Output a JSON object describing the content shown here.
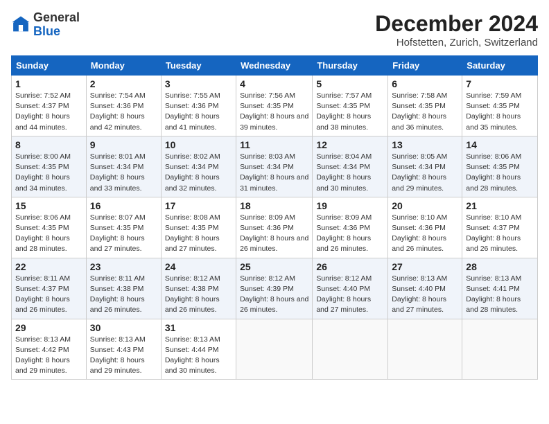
{
  "header": {
    "logo": {
      "general": "General",
      "blue": "Blue"
    },
    "title": "December 2024",
    "location": "Hofstetten, Zurich, Switzerland"
  },
  "days_of_week": [
    "Sunday",
    "Monday",
    "Tuesday",
    "Wednesday",
    "Thursday",
    "Friday",
    "Saturday"
  ],
  "weeks": [
    [
      {
        "day": "1",
        "sunrise": "7:52 AM",
        "sunset": "4:37 PM",
        "daylight": "8 hours and 44 minutes."
      },
      {
        "day": "2",
        "sunrise": "7:54 AM",
        "sunset": "4:36 PM",
        "daylight": "8 hours and 42 minutes."
      },
      {
        "day": "3",
        "sunrise": "7:55 AM",
        "sunset": "4:36 PM",
        "daylight": "8 hours and 41 minutes."
      },
      {
        "day": "4",
        "sunrise": "7:56 AM",
        "sunset": "4:35 PM",
        "daylight": "8 hours and 39 minutes."
      },
      {
        "day": "5",
        "sunrise": "7:57 AM",
        "sunset": "4:35 PM",
        "daylight": "8 hours and 38 minutes."
      },
      {
        "day": "6",
        "sunrise": "7:58 AM",
        "sunset": "4:35 PM",
        "daylight": "8 hours and 36 minutes."
      },
      {
        "day": "7",
        "sunrise": "7:59 AM",
        "sunset": "4:35 PM",
        "daylight": "8 hours and 35 minutes."
      }
    ],
    [
      {
        "day": "8",
        "sunrise": "8:00 AM",
        "sunset": "4:35 PM",
        "daylight": "8 hours and 34 minutes."
      },
      {
        "day": "9",
        "sunrise": "8:01 AM",
        "sunset": "4:34 PM",
        "daylight": "8 hours and 33 minutes."
      },
      {
        "day": "10",
        "sunrise": "8:02 AM",
        "sunset": "4:34 PM",
        "daylight": "8 hours and 32 minutes."
      },
      {
        "day": "11",
        "sunrise": "8:03 AM",
        "sunset": "4:34 PM",
        "daylight": "8 hours and 31 minutes."
      },
      {
        "day": "12",
        "sunrise": "8:04 AM",
        "sunset": "4:34 PM",
        "daylight": "8 hours and 30 minutes."
      },
      {
        "day": "13",
        "sunrise": "8:05 AM",
        "sunset": "4:34 PM",
        "daylight": "8 hours and 29 minutes."
      },
      {
        "day": "14",
        "sunrise": "8:06 AM",
        "sunset": "4:35 PM",
        "daylight": "8 hours and 28 minutes."
      }
    ],
    [
      {
        "day": "15",
        "sunrise": "8:06 AM",
        "sunset": "4:35 PM",
        "daylight": "8 hours and 28 minutes."
      },
      {
        "day": "16",
        "sunrise": "8:07 AM",
        "sunset": "4:35 PM",
        "daylight": "8 hours and 27 minutes."
      },
      {
        "day": "17",
        "sunrise": "8:08 AM",
        "sunset": "4:35 PM",
        "daylight": "8 hours and 27 minutes."
      },
      {
        "day": "18",
        "sunrise": "8:09 AM",
        "sunset": "4:36 PM",
        "daylight": "8 hours and 26 minutes."
      },
      {
        "day": "19",
        "sunrise": "8:09 AM",
        "sunset": "4:36 PM",
        "daylight": "8 hours and 26 minutes."
      },
      {
        "day": "20",
        "sunrise": "8:10 AM",
        "sunset": "4:36 PM",
        "daylight": "8 hours and 26 minutes."
      },
      {
        "day": "21",
        "sunrise": "8:10 AM",
        "sunset": "4:37 PM",
        "daylight": "8 hours and 26 minutes."
      }
    ],
    [
      {
        "day": "22",
        "sunrise": "8:11 AM",
        "sunset": "4:37 PM",
        "daylight": "8 hours and 26 minutes."
      },
      {
        "day": "23",
        "sunrise": "8:11 AM",
        "sunset": "4:38 PM",
        "daylight": "8 hours and 26 minutes."
      },
      {
        "day": "24",
        "sunrise": "8:12 AM",
        "sunset": "4:38 PM",
        "daylight": "8 hours and 26 minutes."
      },
      {
        "day": "25",
        "sunrise": "8:12 AM",
        "sunset": "4:39 PM",
        "daylight": "8 hours and 26 minutes."
      },
      {
        "day": "26",
        "sunrise": "8:12 AM",
        "sunset": "4:40 PM",
        "daylight": "8 hours and 27 minutes."
      },
      {
        "day": "27",
        "sunrise": "8:13 AM",
        "sunset": "4:40 PM",
        "daylight": "8 hours and 27 minutes."
      },
      {
        "day": "28",
        "sunrise": "8:13 AM",
        "sunset": "4:41 PM",
        "daylight": "8 hours and 28 minutes."
      }
    ],
    [
      {
        "day": "29",
        "sunrise": "8:13 AM",
        "sunset": "4:42 PM",
        "daylight": "8 hours and 29 minutes."
      },
      {
        "day": "30",
        "sunrise": "8:13 AM",
        "sunset": "4:43 PM",
        "daylight": "8 hours and 29 minutes."
      },
      {
        "day": "31",
        "sunrise": "8:13 AM",
        "sunset": "4:44 PM",
        "daylight": "8 hours and 30 minutes."
      },
      null,
      null,
      null,
      null
    ]
  ],
  "labels": {
    "sunrise": "Sunrise:",
    "sunset": "Sunset:",
    "daylight": "Daylight:"
  }
}
